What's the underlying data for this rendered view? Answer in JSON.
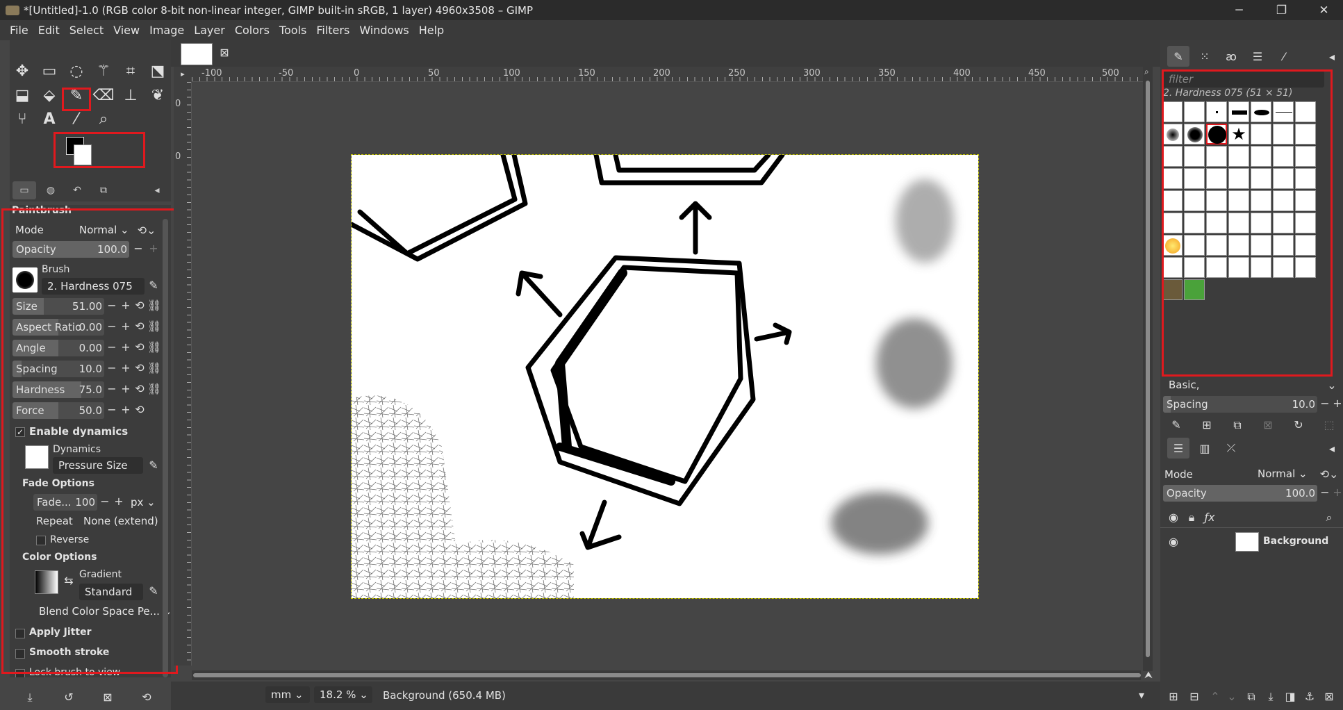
{
  "window": {
    "title": "*[Untitled]-1.0 (RGB color 8-bit non-linear integer, GIMP built-in sRGB, 1 layer) 4960x3508 – GIMP",
    "minimize": "─",
    "maximize": "❐",
    "close": "✕"
  },
  "menu": [
    "File",
    "Edit",
    "Select",
    "View",
    "Image",
    "Layer",
    "Colors",
    "Tools",
    "Filters",
    "Windows",
    "Help"
  ],
  "tool_options": {
    "header": "Paintbrush",
    "mode_label": "Mode",
    "mode_value": "Normal",
    "opacity": {
      "label": "Opacity",
      "value": "100.0"
    },
    "brush_label": "Brush",
    "brush_value": "2. Hardness 075",
    "size": {
      "label": "Size",
      "value": "51.00"
    },
    "aspect_ratio": {
      "label": "Aspect Ratio",
      "value": "0.00"
    },
    "angle": {
      "label": "Angle",
      "value": "0.00"
    },
    "spacing": {
      "label": "Spacing",
      "value": "10.0"
    },
    "hardness": {
      "label": "Hardness",
      "value": "75.0"
    },
    "force": {
      "label": "Force",
      "value": "50.0"
    },
    "enable_dynamics": "Enable dynamics",
    "dynamics_label": "Dynamics",
    "dynamics_value": "Pressure Size",
    "fade_options": "Fade Options",
    "fade_length_label": "Fade...",
    "fade_length_value": "100",
    "fade_unit": "px",
    "repeat_label": "Repeat",
    "repeat_value": "None (extend)",
    "reverse": "Reverse",
    "color_options": "Color Options",
    "gradient_label": "Gradient",
    "gradient_value": "Standard",
    "blend_space": "Blend Color Space Pe...",
    "apply_jitter": "Apply Jitter",
    "smooth_stroke": "Smooth stroke",
    "lock_brush": "Lock brush to view"
  },
  "ruler_top": [
    "-100",
    "-50",
    "0",
    "50",
    "100",
    "150",
    "200",
    "250",
    "300",
    "350",
    "400",
    "450",
    "500"
  ],
  "ruler_left": [
    "0",
    "0"
  ],
  "status": {
    "unit": "mm",
    "zoom": "18.2 %",
    "info": "Background (650.4 MB)"
  },
  "brushes_panel": {
    "filter_placeholder": "filter",
    "selected_brush": "2. Hardness 075 (51 × 51)",
    "preset": "Basic,",
    "spacing_label": "Spacing",
    "spacing_value": "10.0"
  },
  "layers_panel": {
    "mode_label": "Mode",
    "mode_value": "Normal",
    "opacity_label": "Opacity",
    "opacity_value": "100.0",
    "layer_name": "Background"
  },
  "colors": {
    "foreground": "#000000",
    "background": "#ffffff",
    "highlight": "#e0191e"
  }
}
